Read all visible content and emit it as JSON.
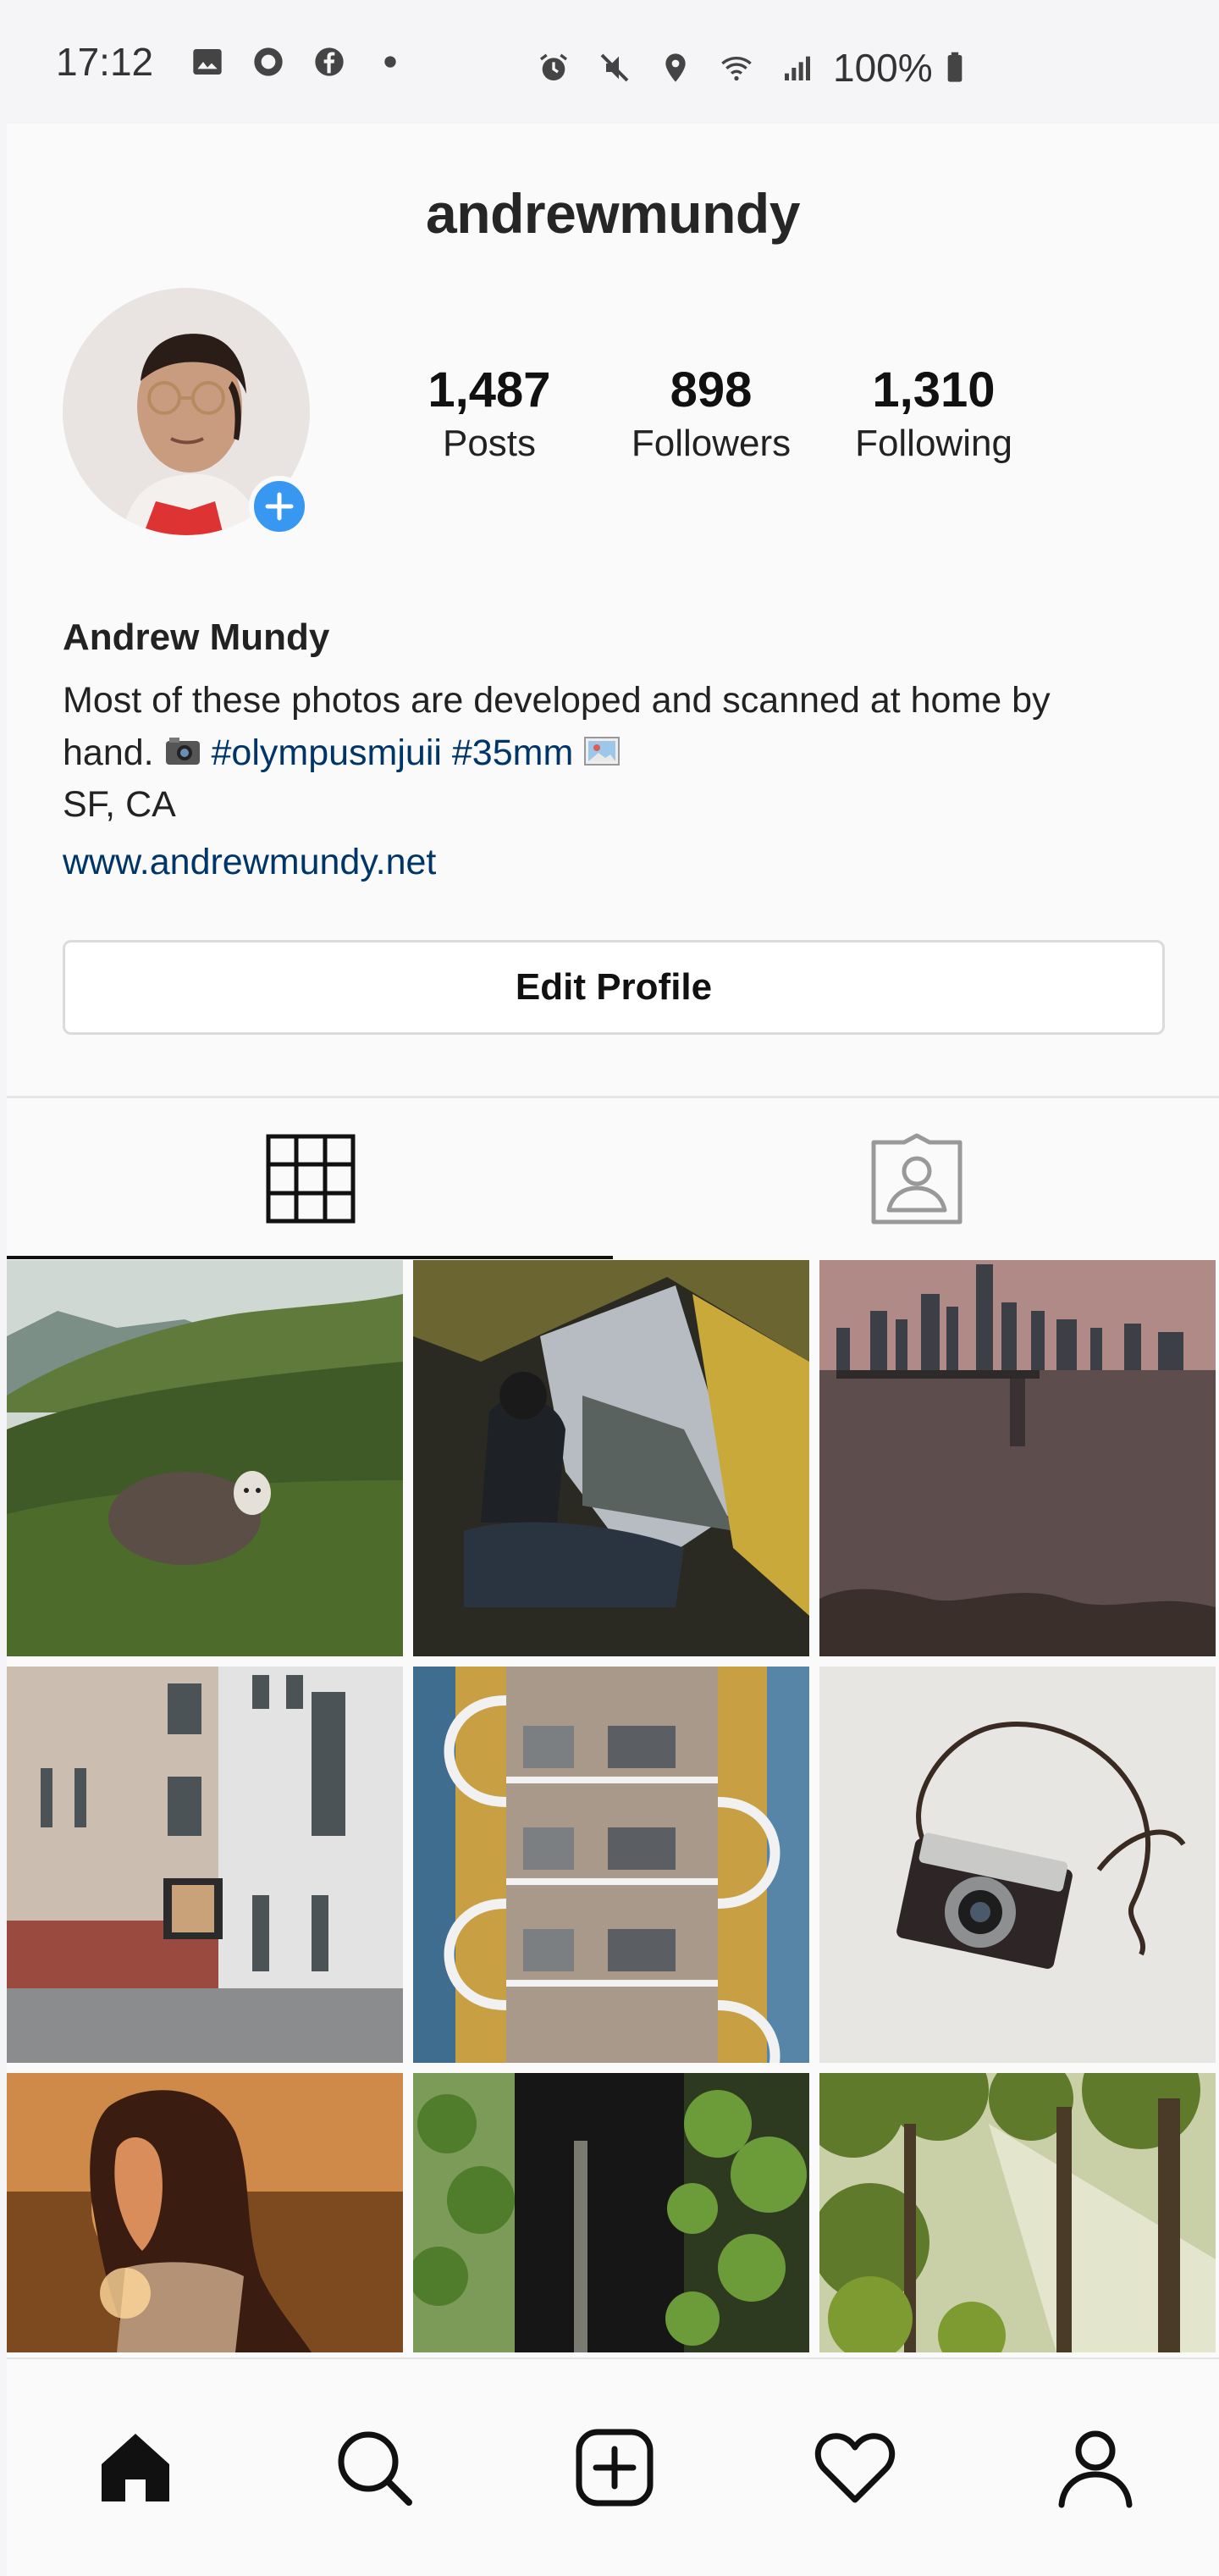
{
  "status_bar": {
    "time": "17:12",
    "battery": "100%",
    "left_icons": [
      "image-icon",
      "opera-icon",
      "facebook-icon",
      "dot-icon"
    ],
    "right_icons": [
      "alarm-icon",
      "mute-icon",
      "location-icon",
      "wifi-icon",
      "signal-icon",
      "battery-icon"
    ]
  },
  "profile": {
    "username": "andrewmundy",
    "stats": [
      {
        "value": "1,487",
        "label": "Posts"
      },
      {
        "value": "898",
        "label": "Followers"
      },
      {
        "value": "1,310",
        "label": "Following"
      }
    ],
    "name": "Andrew Mundy",
    "bio_line1": "Most of these photos are developed and scanned at home by",
    "bio_line2_text": "hand.",
    "bio_tags": "#olympusmjuii #35mm",
    "location": "SF, CA",
    "website": "www.andrewmundy.net",
    "edit_button": "Edit Profile"
  },
  "tabs": [
    {
      "icon": "grid-icon",
      "active": true
    },
    {
      "icon": "tagged-person-icon",
      "active": false
    }
  ],
  "photos": [
    "sheep-on-hillside",
    "person-in-tent",
    "city-skyline-pier",
    "building-facade-street",
    "spiral-staircase-facade",
    "vintage-camera",
    "woman-backlit-sunset",
    "dark-cabin-foliage",
    "sunlit-forest"
  ],
  "nav": [
    {
      "icon": "home-icon"
    },
    {
      "icon": "search-icon"
    },
    {
      "icon": "add-post-icon"
    },
    {
      "icon": "heart-icon"
    },
    {
      "icon": "profile-icon"
    }
  ],
  "colors": {
    "accent": "#3897f0",
    "link": "#003569",
    "background": "#fafafa"
  }
}
